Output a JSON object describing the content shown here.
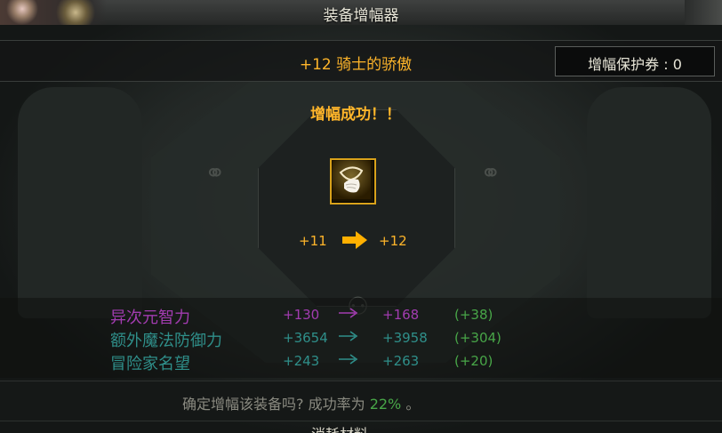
{
  "window": {
    "title": "装备增幅器"
  },
  "header": {
    "item_name": "+12 骑士的骄傲",
    "protection_ticket": "增幅保护券 : 0"
  },
  "result": {
    "message": "增幅成功！！",
    "item_icon": "angel-wing-necklace-icon",
    "from_level": "+11",
    "to_level": "+12"
  },
  "stats": [
    {
      "name": "异次元智力",
      "old": "+130",
      "new": "+168",
      "diff": "(+38)",
      "color": "#a23cb0"
    },
    {
      "name": "额外魔法防御力",
      "old": "+3654",
      "new": "+3958",
      "diff": "(+304)",
      "color": "#2f8f8a"
    },
    {
      "name": "冒险家名望",
      "old": "+243",
      "new": "+263",
      "diff": "(+20)",
      "color": "#2f8f8a"
    }
  ],
  "confirm": {
    "text": "确定增幅该装备吗? 成功率为",
    "rate": "22%",
    "suffix": "。"
  },
  "footer": {
    "partial_label": "消耗材料"
  },
  "colors": {
    "gold": "#ffb52a",
    "success_green": "#48a648"
  }
}
